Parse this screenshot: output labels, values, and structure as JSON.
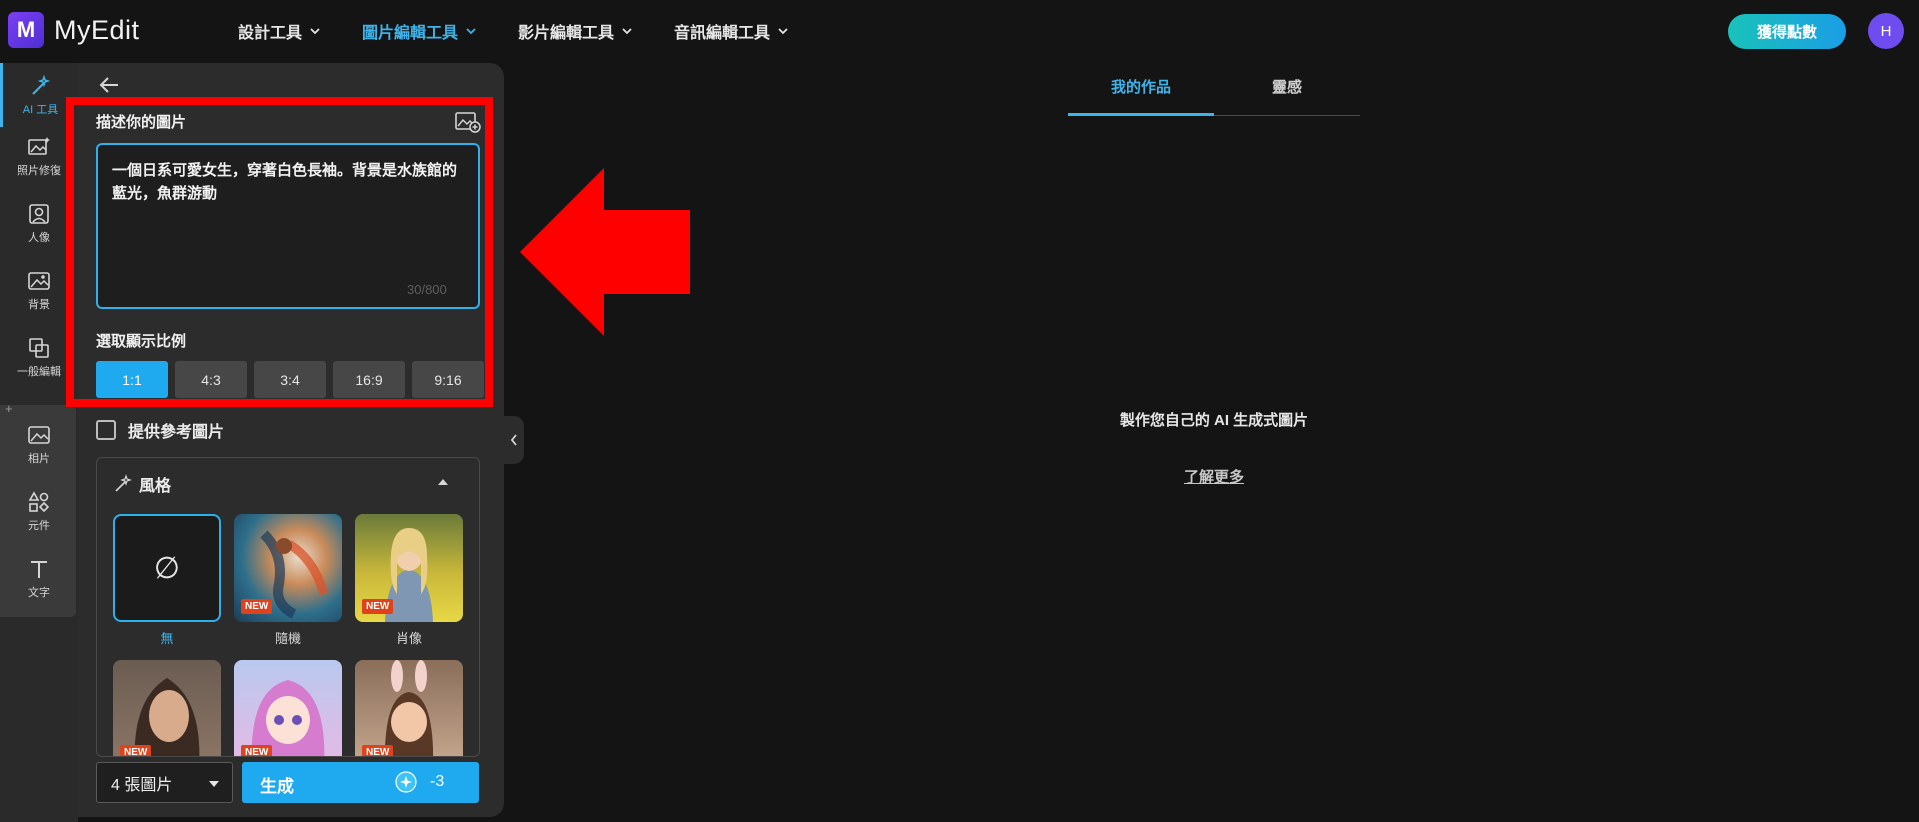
{
  "app": {
    "logo_letter": "M",
    "name": "MyEdit"
  },
  "nav": [
    {
      "label": "設計工具",
      "active": false
    },
    {
      "label": "圖片編輯工具",
      "active": true
    },
    {
      "label": "影片編輯工具",
      "active": false
    },
    {
      "label": "音訊編輯工具",
      "active": false
    }
  ],
  "header": {
    "points_button": "獲得點數",
    "avatar_initial": "H"
  },
  "rail": [
    {
      "label": "AI 工具",
      "icon": "magic-wand-icon",
      "active": true
    },
    {
      "label": "照片修復",
      "icon": "photo-repair-icon"
    },
    {
      "label": "人像",
      "icon": "portrait-icon"
    },
    {
      "label": "背景",
      "icon": "background-icon"
    },
    {
      "label": "一般編輯",
      "icon": "general-edit-icon"
    },
    {
      "label": "相片",
      "icon": "photo-icon"
    },
    {
      "label": "元件",
      "icon": "elements-icon"
    },
    {
      "label": "文字",
      "icon": "text-icon"
    }
  ],
  "rail_plus": "+",
  "panel": {
    "describe_label": "描述你的圖片",
    "prompt_text": "一個日系可愛女生，穿著白色長袖。背景是水族館的藍光，魚群游動",
    "char_count": "30/800",
    "ratio_label": "選取顯示比例",
    "ratios": [
      {
        "label": "1:1",
        "active": true
      },
      {
        "label": "4:3"
      },
      {
        "label": "3:4"
      },
      {
        "label": "16:9"
      },
      {
        "label": "9:16"
      }
    ],
    "reference_label": "提供參考圖片",
    "style_title": "風格",
    "styles": [
      {
        "caption": "無",
        "symbol": "∅",
        "active": true
      },
      {
        "caption": "隨機",
        "badge": "NEW"
      },
      {
        "caption": "肖像",
        "badge": "NEW"
      },
      {
        "caption": "",
        "badge": "NEW"
      },
      {
        "caption": "",
        "badge": "NEW"
      },
      {
        "caption": "",
        "badge": "NEW"
      }
    ],
    "image_count": "4 張圖片",
    "generate_label": "生成",
    "credit_cost": "-3"
  },
  "right": {
    "tabs": [
      {
        "label": "我的作品",
        "active": true
      },
      {
        "label": "靈感",
        "active": false
      }
    ],
    "empty_title": "製作您自己的 AI 生成式圖片",
    "learn_more": "了解更多"
  },
  "colors": {
    "accent": "#1faaf0",
    "highlight_red": "#ff0000",
    "new_badge": "#e0421b"
  }
}
